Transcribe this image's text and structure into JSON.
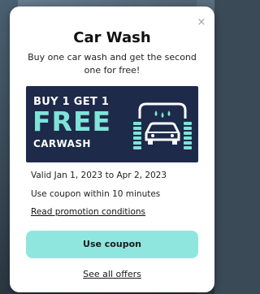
{
  "dialog": {
    "title": "Car Wash",
    "subtitle": "Buy one car wash and get the second one for free!",
    "close_glyph": "×"
  },
  "banner": {
    "line1": "BUY 1 GET 1",
    "line2": "FREE",
    "line3": "CARWASH",
    "icon": "carwash-icon",
    "colors": {
      "background": "#1e2a4a",
      "accent": "#7fe3d8",
      "text": "#ffffff"
    }
  },
  "details": {
    "validity": "Valid Jan 1, 2023 to Apr 2, 2023",
    "usage_window": "Use coupon within 10 minutes",
    "conditions_link": "Read promotion conditions"
  },
  "actions": {
    "use_coupon": "Use coupon",
    "see_all_offers": "See all offers",
    "button_color": "#8fe6df"
  }
}
